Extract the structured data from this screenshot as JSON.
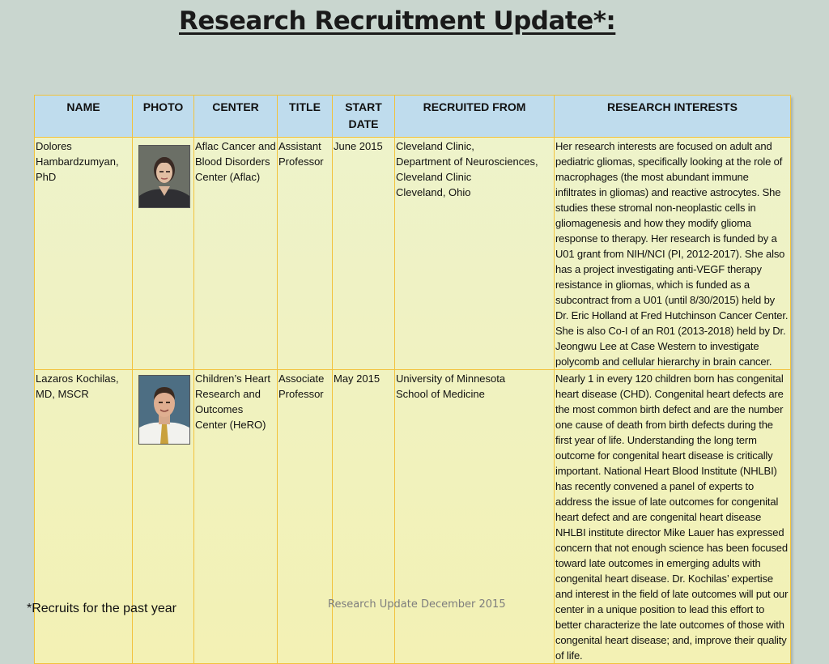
{
  "title": "Research Recruitment Update*:",
  "table": {
    "headers": [
      "NAME",
      "PHOTO",
      "CENTER",
      "TITLE",
      "START DATE",
      "RECRUITED FROM",
      "RESEARCH INTERESTS"
    ],
    "rows": [
      {
        "name": "Dolores Hambardzumyan, PhD",
        "photo": "woman-portrait",
        "center": "Aflac Cancer and Blood Disorders Center (Aflac)",
        "title": "Assistant Professor",
        "start_date": "June 2015",
        "recruited_from_lines": [
          "Cleveland Clinic,",
          "Department of Neurosciences,",
          "Cleveland Clinic",
          "Cleveland, Ohio"
        ],
        "research_interests": "Her research interests are focused on adult and pediatric gliomas, specifically looking at the role of macrophages (the most abundant immune infiltrates in gliomas) and reactive astrocytes. She studies these stromal non-neoplastic cells in gliomagenesis and how they modify glioma response to therapy. Her research is funded by a U01 grant from NIH/NCI (PI, 2012-2017). She also has a project investigating anti-VEGF therapy resistance in gliomas, which is funded as a subcontract from a U01 (until 8/30/2015) held by Dr. Eric Holland at Fred Hutchinson Cancer Center. She is also Co-I of an R01 (2013-2018) held by Dr. Jeongwu Lee at Case Western to investigate polycomb and cellular hierarchy in brain cancer."
      },
      {
        "name": "Lazaros Kochilas, MD, MSCR",
        "photo": "man-portrait",
        "center": "Children’s Heart Research and Outcomes Center (HeRO)",
        "title": "Associate Professor",
        "start_date": "May 2015",
        "recruited_from_lines": [
          "University of Minnesota",
          "School of Medicine"
        ],
        "research_interests": "Nearly 1 in every 120 children born has congenital heart disease (CHD). Congenital heart defects are the most common birth defect and are the number one cause of death from birth defects during the first year of life. Understanding the long term outcome for congenital heart disease is critically important. National Heart Blood Institute (NHLBI) has recently convened a panel of experts to address the issue of late outcomes for congenital heart defect and are congenital heart disease NHLBI institute director Mike Lauer has expressed concern that not enough science has been focused toward late outcomes in emerging adults with congenital heart disease. Dr. Kochilas’ expertise and interest in the field of late outcomes will put our center in a unique position to lead this effort to better characterize the late outcomes of those with congenital heart disease; and, improve their quality of life."
      }
    ]
  },
  "footnote": "*Recruits for the past year",
  "footer": "Research Update December 2015"
}
